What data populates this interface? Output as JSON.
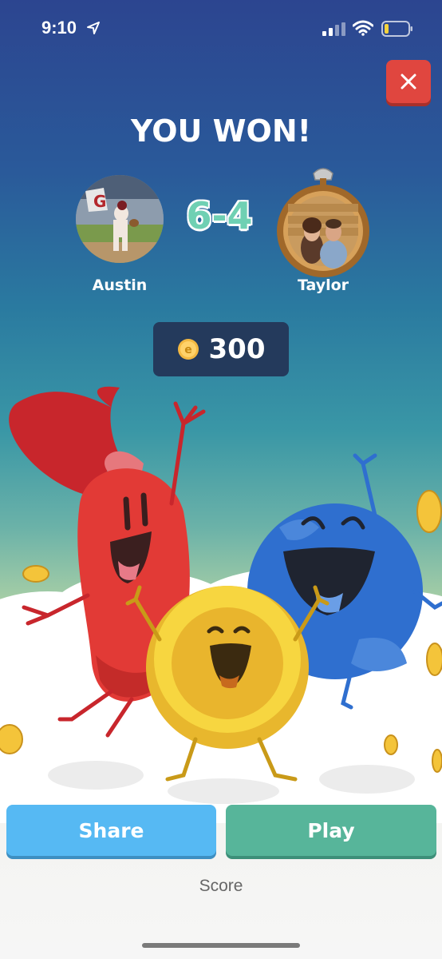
{
  "status_bar": {
    "time": "9:10"
  },
  "result": {
    "title": "YOU WON!",
    "score": "6-4"
  },
  "players": {
    "left": {
      "name": "Austin"
    },
    "right": {
      "name": "Taylor"
    }
  },
  "reward": {
    "coin_letter": "e",
    "amount": "300"
  },
  "actions": {
    "share_label": "Share",
    "play_label": "Play",
    "score_label": "Score"
  },
  "colors": {
    "close": "#e0463f",
    "share": "#56b9f3",
    "play": "#57b59a",
    "score": "#6fd0b3",
    "reward_box": "#243a5c"
  },
  "icons": [
    "location-arrow-icon",
    "cellular-signal-icon",
    "wifi-icon",
    "battery-icon",
    "close-icon",
    "coin-icon"
  ]
}
